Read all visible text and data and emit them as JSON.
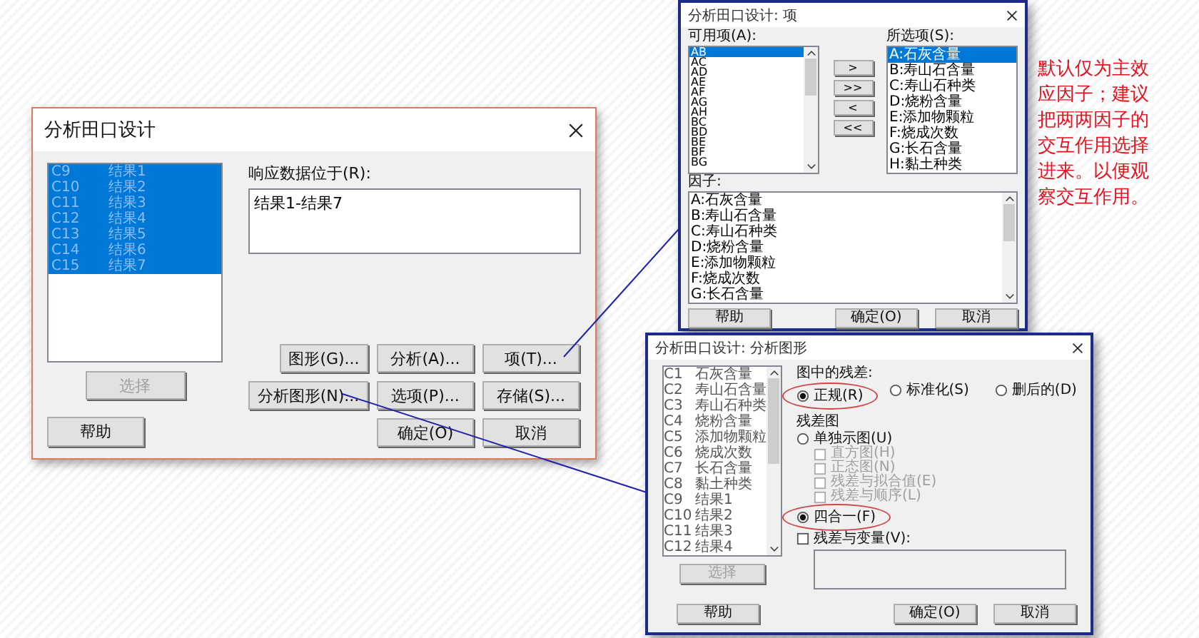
{
  "main_dialog": {
    "title": "分析田口设计",
    "columns": [
      {
        "column": "C9",
        "name": "结果1",
        "selected": true
      },
      {
        "column": "C10",
        "name": "结果2",
        "selected": true
      },
      {
        "column": "C11",
        "name": "结果3",
        "selected": true
      },
      {
        "column": "C12",
        "name": "结果4",
        "selected": true
      },
      {
        "column": "C13",
        "name": "结果5",
        "selected": true
      },
      {
        "column": "C14",
        "name": "结果6",
        "selected": true
      },
      {
        "column": "C15",
        "name": "结果7",
        "selected": true
      }
    ],
    "select_button": {
      "label": "选择",
      "disabled": true
    },
    "response_label": "响应数据位于(R):",
    "response_value": "结果1-结果7",
    "button_rows": [
      [
        "图形(G)...",
        "分析(A)...",
        "项(T)..."
      ],
      [
        "分析图形(N)...",
        "选项(P)...",
        "存储(S)..."
      ]
    ],
    "help_button": "帮助",
    "ok_button": "确定(O)",
    "cancel_button": "取消"
  },
  "terms_dialog": {
    "title": "分析田口设计: 项",
    "available_label": "可用项(A):",
    "available": [
      {
        "label": "AB",
        "selected": true
      },
      {
        "label": "AC",
        "selected": false
      },
      {
        "label": "AD",
        "selected": false
      },
      {
        "label": "AE",
        "selected": false
      },
      {
        "label": "AF",
        "selected": false
      },
      {
        "label": "AG",
        "selected": false
      },
      {
        "label": "AH",
        "selected": false
      },
      {
        "label": "BC",
        "selected": false
      },
      {
        "label": "BD",
        "selected": false
      },
      {
        "label": "BE",
        "selected": false
      },
      {
        "label": "BF",
        "selected": false
      },
      {
        "label": "BG",
        "selected": false
      }
    ],
    "move_buttons": [
      ">",
      ">>",
      "<",
      "<<"
    ],
    "chosen_label": "所选项(S):",
    "chosen": [
      {
        "label": "A:石灰含量",
        "selected": true
      },
      {
        "label": "B:寿山石含量",
        "selected": false
      },
      {
        "label": "C:寿山石种类",
        "selected": false
      },
      {
        "label": "D:烧粉含量",
        "selected": false
      },
      {
        "label": "E:添加物颗粒",
        "selected": false
      },
      {
        "label": "F:烧成次数",
        "selected": false
      },
      {
        "label": "G:长石含量",
        "selected": false
      },
      {
        "label": "H:黏土种类",
        "selected": false
      }
    ],
    "factors_label": "因子:",
    "factors": [
      "A:石灰含量",
      "B:寿山石含量",
      "C:寿山石种类",
      "D:烧粉含量",
      "E:添加物颗粒",
      "F:烧成次数",
      "G:长石含量"
    ],
    "help_button": "帮助",
    "ok_button": "确定(O)",
    "cancel_button": "取消"
  },
  "graphs_dialog": {
    "title": "分析田口设计: 分析图形",
    "columns": [
      {
        "column": "C1",
        "name": "石灰含量"
      },
      {
        "column": "C2",
        "name": "寿山石含量"
      },
      {
        "column": "C3",
        "name": "寿山石种类"
      },
      {
        "column": "C4",
        "name": "烧粉含量"
      },
      {
        "column": "C5",
        "name": "添加物颗粒"
      },
      {
        "column": "C6",
        "name": "烧成次数"
      },
      {
        "column": "C7",
        "name": "长石含量"
      },
      {
        "column": "C8",
        "name": "黏土种类"
      },
      {
        "column": "C9",
        "name": "结果1"
      },
      {
        "column": "C10",
        "name": "结果2"
      },
      {
        "column": "C11",
        "name": "结果3"
      },
      {
        "column": "C12",
        "name": "结果4"
      }
    ],
    "select_button": {
      "label": "选择",
      "disabled": true
    },
    "residuals_label": "图中的残差:",
    "residual_types": [
      {
        "label": "正规(R)",
        "selected": true,
        "circled": true
      },
      {
        "label": "标准化(S)",
        "selected": false,
        "circled": false
      },
      {
        "label": "删后的(D)",
        "selected": false,
        "circled": false
      }
    ],
    "plots_label": "残差图",
    "plot_options": [
      {
        "kind": "radio",
        "label": "单独示图(U)",
        "selected": false,
        "circled": false
      },
      {
        "kind": "checkbox",
        "label": "直方图(H)",
        "checked": false,
        "disabled": true
      },
      {
        "kind": "checkbox",
        "label": "正态图(N)",
        "checked": false,
        "disabled": true
      },
      {
        "kind": "checkbox",
        "label": "残差与拟合值(E)",
        "checked": false,
        "disabled": true
      },
      {
        "kind": "checkbox",
        "label": "残差与顺序(L)",
        "checked": false,
        "disabled": true
      },
      {
        "kind": "radio",
        "label": "四合一(F)",
        "selected": true,
        "circled": true
      }
    ],
    "versus_variables": {
      "label": "残差与变量(V):",
      "checked": false
    },
    "help_button": "帮助",
    "ok_button": "确定(O)",
    "cancel_button": "取消"
  },
  "note": "默认仅为主效应因子；建议把两两因子的交互作用选择进来。以便观察交互作用。"
}
